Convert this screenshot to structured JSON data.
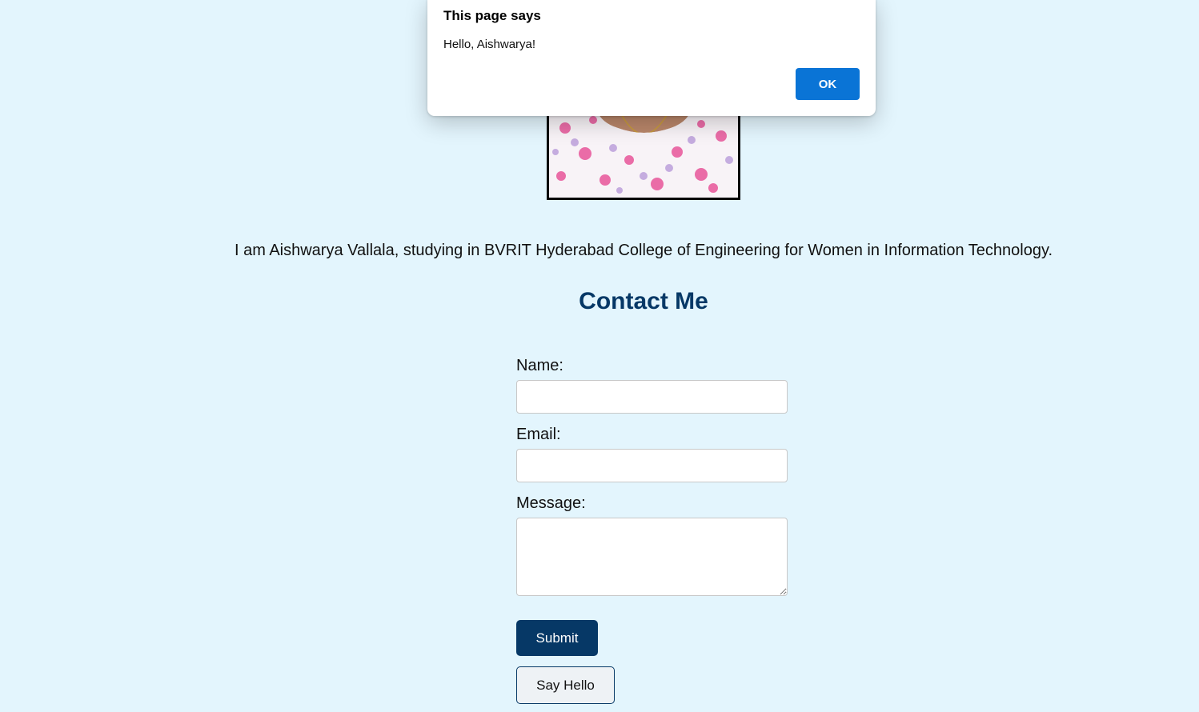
{
  "profile": {
    "bio": "I am Aishwarya Vallala, studying in BVRIT Hyderabad College of Engineering for Women in Information Technology."
  },
  "contact": {
    "title": "Contact Me",
    "name_label": "Name:",
    "email_label": "Email:",
    "message_label": "Message:",
    "name_value": "",
    "email_value": "",
    "message_value": "",
    "submit_label": "Submit",
    "hello_label": "Say Hello"
  },
  "dialog": {
    "title": "This page says",
    "message": "Hello, Aishwarya!",
    "ok_label": "OK"
  },
  "colors": {
    "background": "#e3f5fd",
    "accent": "#063866",
    "dialog_ok": "#0a74d6"
  }
}
